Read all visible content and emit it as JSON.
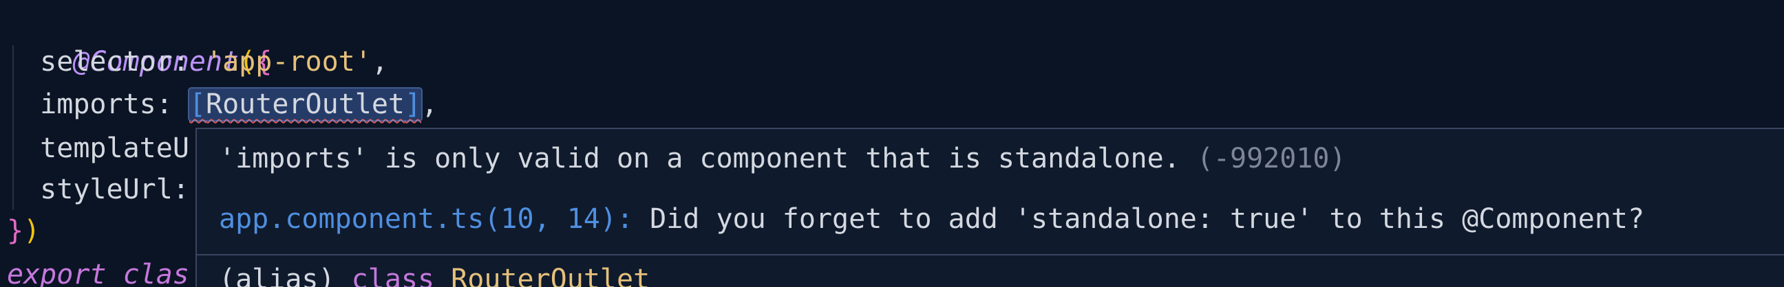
{
  "editor": {
    "line1": {
      "decorator": "@Component",
      "paren_open": "(",
      "brace_open": "{"
    },
    "line2": {
      "key": "selector: ",
      "value": "'app-root'",
      "trail": ","
    },
    "line3": {
      "key": "imports: ",
      "bracket_open": "[",
      "value": "RouterOutlet",
      "bracket_close": "]",
      "trail": ","
    },
    "line4": {
      "key": "templateU"
    },
    "line5": {
      "key": "styleUrl:"
    },
    "line6": {
      "brace_close": "}",
      "paren_close": ")"
    },
    "line7": {
      "keyword": "export",
      "rest": " clas"
    }
  },
  "hover": {
    "message": "'imports' is only valid on a component that is standalone. ",
    "code": "(-992010)",
    "related_link": "app.component.ts(10, 14):",
    "related_text": " Did you forget to add 'standalone: true' to this @Component?",
    "signature_prefix": "(alias) ",
    "signature_keyword": "class",
    "signature_name": " RouterOutlet"
  },
  "colors": {
    "background": "#0b1424",
    "error_squiggle": "#e05a5a",
    "link": "#4f8fe0"
  }
}
